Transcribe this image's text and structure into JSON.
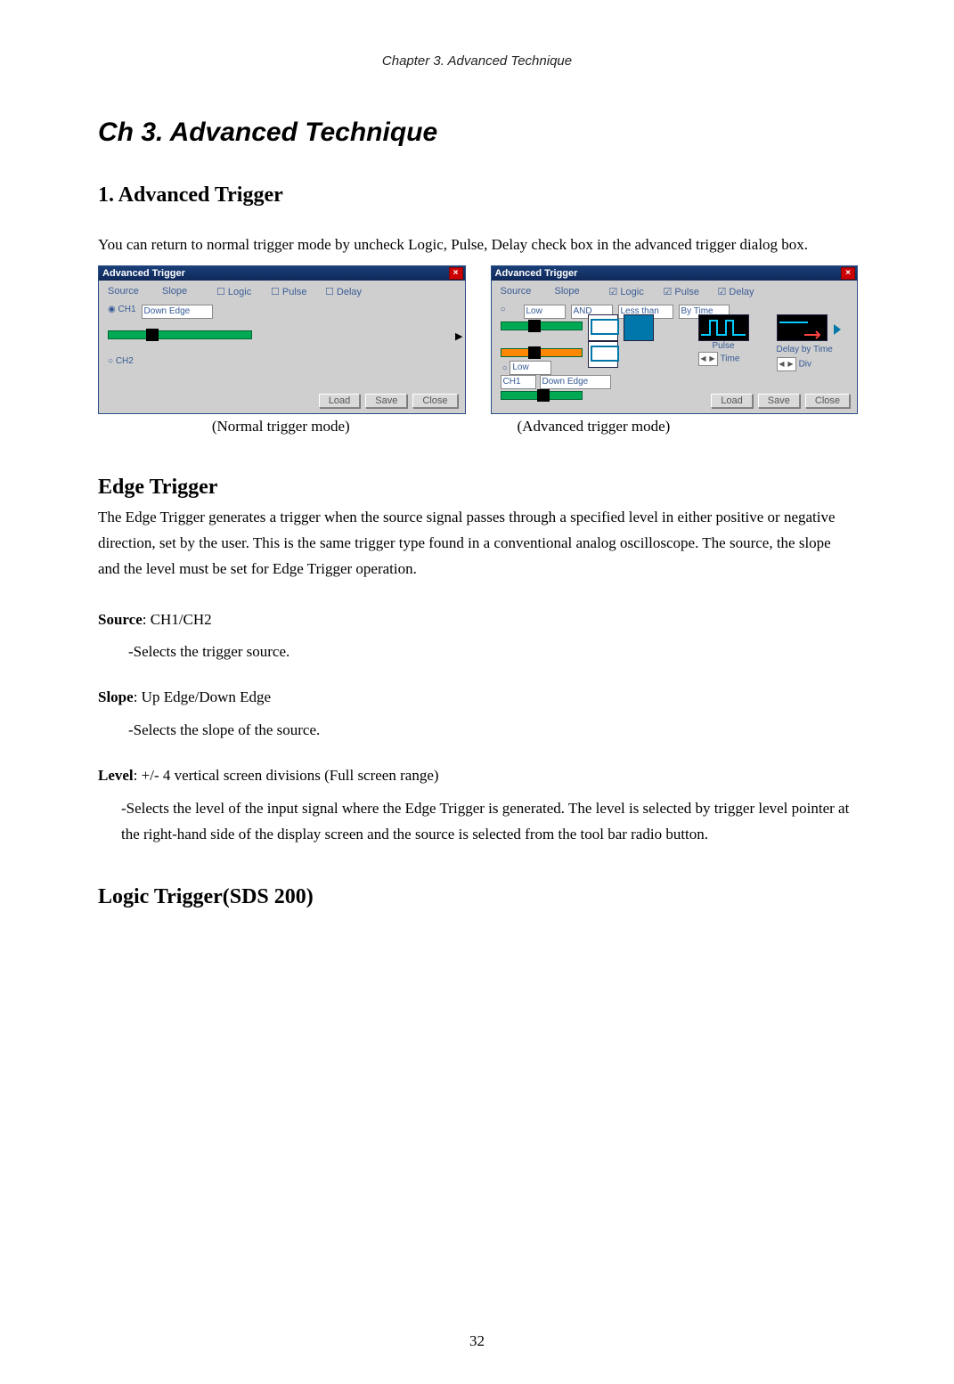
{
  "header": "Chapter 3. Advanced Technique",
  "ch_title": "Ch 3. Advanced Technique",
  "sec1_title": "1. Advanced Trigger",
  "sec1_intro": "You can return to normal trigger mode by uncheck Logic, Pulse, Delay check box in the advanced trigger dialog box.",
  "fig1": {
    "winTitle": "Advanced Trigger",
    "source": "Source",
    "slope": "Slope",
    "logic": "Logic",
    "pulse": "Pulse",
    "delay": "Delay",
    "ch1": "CH1",
    "downedge": "Down Edge",
    "ch2": "CH2",
    "load": "Load",
    "save": "Save",
    "close": "Close",
    "caption": "(Normal trigger mode)"
  },
  "fig2": {
    "winTitle": "Advanced Trigger",
    "source": "Source",
    "slope": "Slope",
    "logic": "Logic",
    "pulse": "Pulse",
    "delay": "Delay",
    "low": "Low",
    "and": "AND",
    "lessthan": "Less than",
    "bytime": "By Time",
    "pulseLab": "Pulse",
    "time": "Time",
    "delaytime": "Delay by Time",
    "div": "Div",
    "ch1": "CH1",
    "downedge": "Down Edge",
    "load": "Load",
    "save": "Save",
    "close": "Close",
    "caption": "(Advanced trigger mode)"
  },
  "edge_title": "Edge Trigger",
  "edge_para": "The Edge Trigger generates a trigger when the source signal passes through a specified level in either positive or negative direction, set by the user. This is the same trigger type found in a conventional analog oscilloscope. The source, the slope and the level must be set for Edge Trigger operation.",
  "source_lbl": "Source",
  "source_val": ": CH1/CH2",
  "source_desc": "-Selects the trigger source.",
  "slope_lbl": "Slope",
  "slope_val": ": Up Edge/Down Edge",
  "slope_desc": "-Selects the slope of the source.",
  "level_lbl": "Level",
  "level_val": ": +/- 4 vertical screen divisions (Full screen range)",
  "level_desc": "-Selects the level of the input signal where the Edge Trigger is generated. The level is selected by trigger level pointer at the right-hand side of the display screen and the source is selected from the tool bar radio button.",
  "logic_title": "Logic Trigger(SDS 200)",
  "pagenum": "32"
}
